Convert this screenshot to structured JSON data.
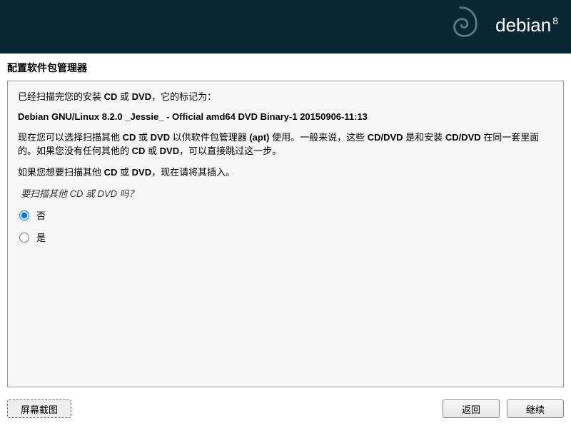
{
  "banner": {
    "brand_name": "debian",
    "brand_version": "8"
  },
  "page": {
    "title": "配置软件包管理器"
  },
  "content": {
    "intro_prefix": "已经扫描完您的安装 ",
    "cd_text": "CD",
    "or_text": " 或 ",
    "dvd_text": "DVD",
    "intro_suffix": "，它的标记为：",
    "media_label": "Debian GNU/Linux 8.2.0 _Jessie_ - Official amd64 DVD Binary-1 20150906-11:13",
    "desc_p1_a": "现在您可以选择扫描其他 ",
    "desc_p1_b": " 以供软件包管理器 ",
    "apt_text": "(apt)",
    "desc_p1_c": " 使用。一般来说，这些 ",
    "cddvd_text": "CD/DVD",
    "desc_p1_d": " 是和安装 ",
    "desc_p1_e": " 在同一套里面的。如果您没有任何其他的 ",
    "desc_p1_f": "，可以直接跳过这一步。",
    "desc_p2_a": "如果您想要扫描其他 ",
    "desc_p2_b": "，现在请将其插入。",
    "question": "要扫描其他 CD 或 DVD 吗？",
    "options": {
      "no_label": "否",
      "yes_label": "是"
    }
  },
  "footer": {
    "screenshot": "屏幕截图",
    "back": "返回",
    "continue": "继续"
  }
}
